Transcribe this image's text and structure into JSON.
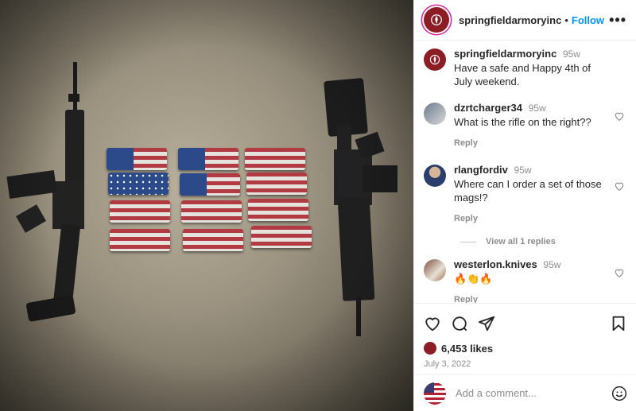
{
  "post": {
    "author": "springfieldarmoryinc",
    "separator": "•",
    "follow_label": "Follow",
    "more_label": "•••"
  },
  "caption": {
    "author": "springfieldarmoryinc",
    "time": "95w",
    "text": "Have a safe and Happy 4th of July weekend."
  },
  "comments": [
    {
      "user": "dzrtcharger34",
      "time": "95w",
      "text": "What is the rifle on the right??",
      "reply_label": "Reply"
    },
    {
      "user": "rlangfordiv",
      "time": "95w",
      "text": "Where can I order a set of those mags!?",
      "reply_label": "Reply",
      "view_replies": "View all 1 replies"
    },
    {
      "user": "westerlon.knives",
      "time": "95w",
      "text": "🔥👏🔥",
      "reply_label": "Reply"
    }
  ],
  "stats": {
    "likes": "6,453 likes",
    "date": "July 3, 2022"
  },
  "add_comment": {
    "placeholder": "Add a comment..."
  },
  "icons": [
    "heart-icon",
    "comment-icon",
    "share-icon",
    "bookmark-icon",
    "emoji-icon",
    "more-icon"
  ],
  "colors": {
    "accent": "#0095f6",
    "brand": "#8c1d24",
    "muted": "#8e8e8e"
  }
}
